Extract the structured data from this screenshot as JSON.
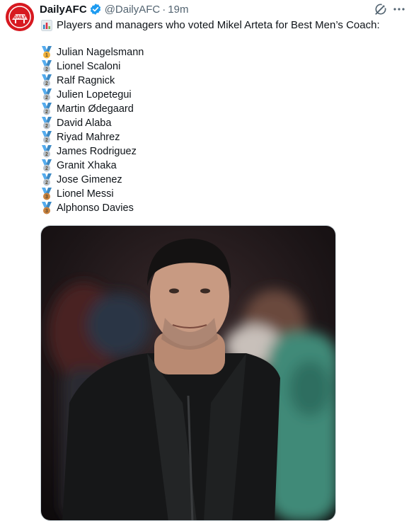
{
  "post": {
    "author_name": "DailyAFC",
    "handle": "@DailyAFC",
    "separator": "·",
    "time": "19m",
    "headline": "Players and managers who voted Mikel Arteta for Best Men’s Coach:",
    "avatar_text": "DAILY AFC",
    "brand_color": "#d71920",
    "verified_color": "#1d9bf0"
  },
  "voters": [
    {
      "name": "Julian Nagelsmann",
      "medal": "gold-medal-icon",
      "place": 1
    },
    {
      "name": "Lionel Scaloni",
      "medal": "silver-medal-icon",
      "place": 2
    },
    {
      "name": "Ralf Ragnick",
      "medal": "silver-medal-icon",
      "place": 2
    },
    {
      "name": "Julien Lopetegui",
      "medal": "silver-medal-icon",
      "place": 2
    },
    {
      "name": "Martin Ødegaard",
      "medal": "silver-medal-icon",
      "place": 2
    },
    {
      "name": "David Alaba",
      "medal": "silver-medal-icon",
      "place": 2
    },
    {
      "name": "Riyad Mahrez",
      "medal": "silver-medal-icon",
      "place": 2
    },
    {
      "name": "James Rodriguez",
      "medal": "silver-medal-icon",
      "place": 2
    },
    {
      "name": "Granit Xhaka",
      "medal": "silver-medal-icon",
      "place": 2
    },
    {
      "name": "Jose Gimenez",
      "medal": "silver-medal-icon",
      "place": 2
    },
    {
      "name": "Lionel Messi",
      "medal": "bronze-medal-icon",
      "place": 3
    },
    {
      "name": "Alphonso Davies",
      "medal": "bronze-medal-icon",
      "place": 3
    }
  ],
  "medal_colors": {
    "1": "#f2b33d",
    "2": "#b8c2cc",
    "3": "#c9823e"
  },
  "ribbon_color": "#55acee"
}
